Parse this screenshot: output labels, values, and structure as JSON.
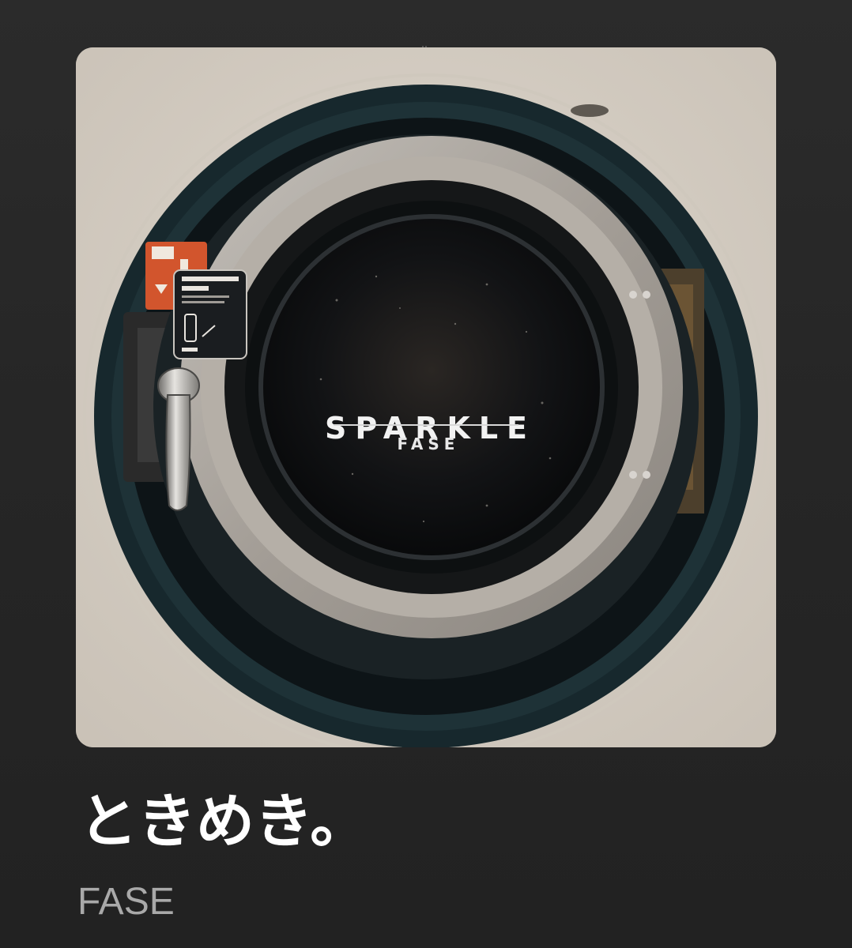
{
  "artwork": {
    "cover_title": "SPARKLE",
    "cover_artist": "FASE",
    "colors": {
      "wall": "#d6cfc5",
      "outer_ring": "#1f3136",
      "steel_ring": "#a7a29c",
      "glass": "#111314",
      "warning_label": "#d2552d"
    },
    "icons": [
      "washing-machine-door",
      "door-handle",
      "door-lever-instruction-label",
      "warning-label"
    ]
  },
  "track": {
    "title": "ときめき。",
    "artist": "FASE"
  }
}
